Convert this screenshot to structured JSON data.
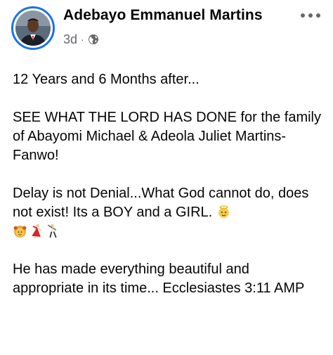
{
  "post": {
    "author": "Adebayo Emmanuel Martins",
    "time": "3d",
    "separator": "·",
    "audience_icon": "globe-icon",
    "more_icon": "more-options-icon",
    "paragraphs": [
      "12 Years and 6 Months after...",
      "SEE WHAT THE LORD HAS DONE for the family of Abayomi Michael & Adeola Juliet Martins-Fanwo!",
      "Delay is not Denial...What God cannot do, does not exist! Its a BOY and a GIRL.",
      "He has made everything beautiful and appropriate in its time... Ecclesiastes 3:11 AMP"
    ],
    "emojis": [
      "baby-angel-emoji",
      "girl-emoji",
      "dancing-woman-emoji",
      "dancing-man-emoji"
    ]
  },
  "colors": {
    "avatar_ring": "#1b74e4",
    "text": "#050505",
    "secondary": "#65676b"
  }
}
